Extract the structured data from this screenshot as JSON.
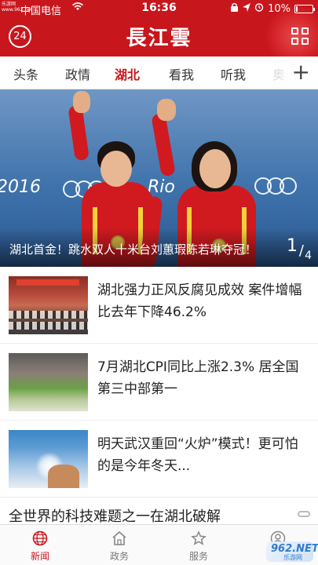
{
  "status_bar": {
    "carrier": "中国电信",
    "watermark": "乐游网\nwww.962.net",
    "time": "16:36",
    "battery_percent": "10%",
    "battery_level": 0.1
  },
  "header": {
    "temperature": "24",
    "logo": "長江雲",
    "menu_icon": "grid-icon"
  },
  "tabs": [
    {
      "label": "头条",
      "active": false
    },
    {
      "label": "政情",
      "active": false
    },
    {
      "label": "湖北",
      "active": true
    },
    {
      "label": "看我",
      "active": false
    },
    {
      "label": "听我",
      "active": false
    },
    {
      "label": "奥",
      "active": false
    }
  ],
  "tabs_add_label": "+",
  "hero": {
    "caption": "湖北首金！跳水双人十米台刘蕙瑕陈若琳夺冠！",
    "page_current": "1",
    "page_separator": "/",
    "page_total": "4",
    "photo_text": "Rio",
    "photo_text_left": "2016"
  },
  "news": [
    {
      "title": "湖北强力正风反腐见成效 案件增幅比去年下降46.2%"
    },
    {
      "title": "7月湖北CPI同比上涨2.3% 居全国第三中部第一"
    },
    {
      "title": "明天武汉重回“火炉”模式！更可怕的是今年冬天..."
    }
  ],
  "partial_news_title": "全世界的科技难题之一在湖北破解",
  "bottom_nav": [
    {
      "label": "新闻",
      "icon": "globe-icon",
      "active": true
    },
    {
      "label": "政务",
      "icon": "home-icon",
      "active": false
    },
    {
      "label": "服务",
      "icon": "star-icon",
      "active": false
    },
    {
      "label": "",
      "icon": "user-icon",
      "active": false
    }
  ],
  "brand_badge": {
    "title": "962.NET",
    "subtitle": "乐游网"
  },
  "colors": {
    "brand_red": "#c8161d",
    "tab_active": "#c8161d"
  }
}
